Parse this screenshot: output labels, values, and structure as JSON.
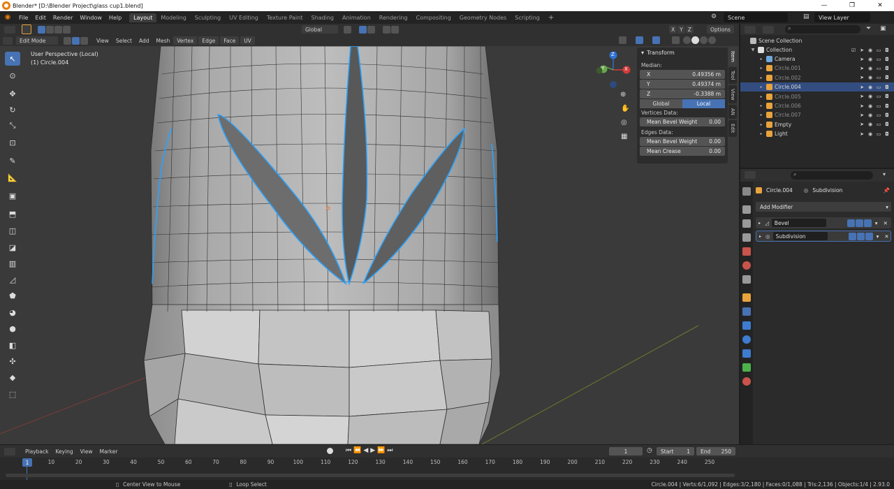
{
  "window": {
    "title": "Blender* [D:\\Blender Project\\glass cup1.blend]",
    "min_glyph": "—",
    "max_glyph": "❐",
    "close_glyph": "✕"
  },
  "menu": [
    "File",
    "Edit",
    "Render",
    "Window",
    "Help"
  ],
  "workspaces": [
    "Layout",
    "Modeling",
    "Sculpting",
    "UV Editing",
    "Texture Paint",
    "Shading",
    "Animation",
    "Rendering",
    "Compositing",
    "Geometry Nodes",
    "Scripting"
  ],
  "active_workspace": "Layout",
  "scene": "Scene",
  "view_layer": "View Layer",
  "header": {
    "transform_orientation": "Global",
    "options": "Options",
    "axes": [
      "X",
      "Y",
      "Z"
    ]
  },
  "header2": {
    "mode": "Edit Mode",
    "menus": [
      "View",
      "Select",
      "Add",
      "Mesh",
      "Vertex",
      "Edge",
      "Face",
      "UV"
    ]
  },
  "viewport": {
    "perspective": "User Perspective (Local)",
    "object": "(1) Circle.004",
    "gizmo_axes": [
      "X",
      "Y",
      "Z"
    ]
  },
  "npanel": {
    "section": "Transform",
    "median_label": "Median:",
    "x_label": "X",
    "x": "0.49356 m",
    "y_label": "Y",
    "y": "0.49374 m",
    "z_label": "Z",
    "z": "-0.3388 m",
    "global": "Global",
    "local": "Local",
    "vertices_data": "Vertices Data:",
    "vert_bevel_label": "Mean Bevel Weight",
    "vert_bevel": "0.00",
    "edges_data": "Edges Data:",
    "edge_bevel_label": "Mean Bevel Weight",
    "edge_bevel": "0.00",
    "crease_label": "Mean Crease",
    "crease": "0.00",
    "tabs": [
      "Item",
      "Tool",
      "View",
      "AN",
      "Edit"
    ]
  },
  "outliner": {
    "root": "Scene Collection",
    "collection": "Collection",
    "items": [
      {
        "name": "Camera",
        "icon_color": "#6fa8dc",
        "dim": false,
        "selected": false
      },
      {
        "name": "Circle.001",
        "icon_color": "#e8a33d",
        "dim": true,
        "selected": false
      },
      {
        "name": "Circle.002",
        "icon_color": "#e8a33d",
        "dim": true,
        "selected": false
      },
      {
        "name": "Circle.004",
        "icon_color": "#e8a33d",
        "dim": false,
        "selected": true
      },
      {
        "name": "Circle.005",
        "icon_color": "#e8a33d",
        "dim": true,
        "selected": false
      },
      {
        "name": "Circle.006",
        "icon_color": "#e8a33d",
        "dim": true,
        "selected": false
      },
      {
        "name": "Circle.007",
        "icon_color": "#e8a33d",
        "dim": true,
        "selected": false
      },
      {
        "name": "Empty",
        "icon_color": "#e8a33d",
        "dim": false,
        "selected": false
      },
      {
        "name": "Light",
        "icon_color": "#e8a33d",
        "dim": false,
        "selected": false
      }
    ]
  },
  "properties": {
    "object": "Circle.004",
    "modifier_context": "Subdivision",
    "add_modifier": "Add Modifier",
    "modifiers": [
      "Bevel",
      "Subdivision"
    ]
  },
  "timeline": {
    "menus": [
      "Playback",
      "Keying",
      "View",
      "Marker"
    ],
    "current_frame": "1",
    "start_label": "Start",
    "start": "1",
    "end_label": "End",
    "end": "250",
    "ticks": [
      "10",
      "20",
      "30",
      "40",
      "50",
      "60",
      "70",
      "80",
      "90",
      "100",
      "110",
      "120",
      "130",
      "140",
      "150",
      "160",
      "170",
      "180",
      "190",
      "200",
      "210",
      "220",
      "230",
      "240",
      "250"
    ],
    "playhead": "1"
  },
  "status": {
    "hint1": "Center View to Mouse",
    "hint2": "Loop Select",
    "stats": "Circle.004 | Verts:6/1,092 | Edges:3/2,180 | Faces:0/1,088 | Tris:2,136 | Objects:1/4 | 2.93.0"
  },
  "colors": {
    "accent": "#4772b3",
    "selection": "#29a3ff",
    "viewport_bg": "#3a3a3a"
  }
}
